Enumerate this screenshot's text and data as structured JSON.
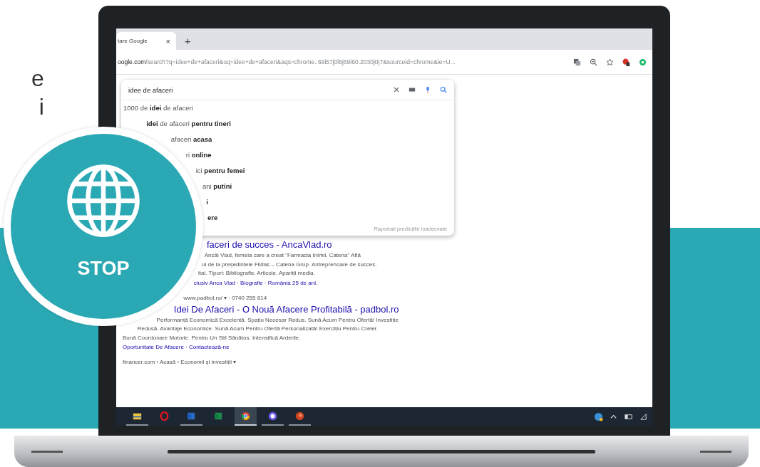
{
  "heading_fragments": [
    "e",
    "i"
  ],
  "badge": {
    "label": "STOP"
  },
  "browser": {
    "tab": {
      "title": "tare Google",
      "close": "×"
    },
    "new_tab": "+",
    "address": {
      "domain": "oogle.com",
      "path": "/search?q=idee+de+afaceri&oq=idee+de+afaceri&aqs=chrome..69i57j0l6j69i60.2030j0j7&sourceid=chrome&ie=U..."
    }
  },
  "search": {
    "value": "idee de afaceri",
    "suggestions": [
      {
        "text": "1000 de **idei** de afaceri",
        "bold": false
      },
      {
        "text": "**idei** de afaceri **pentru tineri**",
        "bold": false
      },
      {
        "text": "afaceri **acasa**",
        "bold": false
      },
      {
        "text": "ri **online**",
        "bold": false
      },
      {
        "text": "ici **pentru femei**",
        "bold": false
      },
      {
        "text": "ani **putini**",
        "bold": false
      },
      {
        "text": "i",
        "bold": true
      },
      {
        "text": "ere",
        "bold": true
      }
    ],
    "report_link": "Raportați predicțiile inadecvate"
  },
  "results": [
    {
      "title": "faceri de succes - AncaVlad.ro",
      "snippet": [
        "Ancăi Vlad, femeia care a creat \"Farmacia Inimii, Catena\" Află",
        "ui de la președintele Fildas – Catena Grup. Antreprenoare de succes.",
        "ital. Tipuri: Bibliografie. Articole. Apariții media."
      ],
      "links": "clusiv Anca Vlad · Biografie · România 25 de ani."
    },
    {
      "url": "www.padbol.ro/ ▾ · 0740 255 814",
      "title": "Idei De Afaceri - O Nouă Afacere Profitabilă - padbol.ro",
      "snippet": [
        "Performanță Economică Excelentă. Spațiu Necesar Redus. Sună Acum Pentru Ofertă! Investiție",
        "Redusă. Avantaje Economice. Sună Acum Pentru Ofertă Personalizată! Exercițiu Pentru Creier.",
        "Bună Coordonare Motorie. Pentru Un Stil Sănătos. Intensifică Arderile."
      ],
      "links": "Oportunitate De Afacere · Contactează-ne"
    },
    {
      "url": "financer.com › Acasă › Economii și investiții ▾"
    }
  ],
  "taskbar": {
    "apps": [
      {
        "kind": "folder",
        "running": true,
        "selected": false
      },
      {
        "kind": "ring",
        "running": false,
        "selected": false
      },
      {
        "kind": "doc",
        "running": true,
        "selected": false
      },
      {
        "kind": "sheet",
        "running": false,
        "selected": false
      },
      {
        "kind": "browser",
        "running": true,
        "selected": true
      },
      {
        "kind": "phone",
        "running": true,
        "selected": false
      },
      {
        "kind": "slides",
        "running": true,
        "selected": false
      }
    ]
  }
}
